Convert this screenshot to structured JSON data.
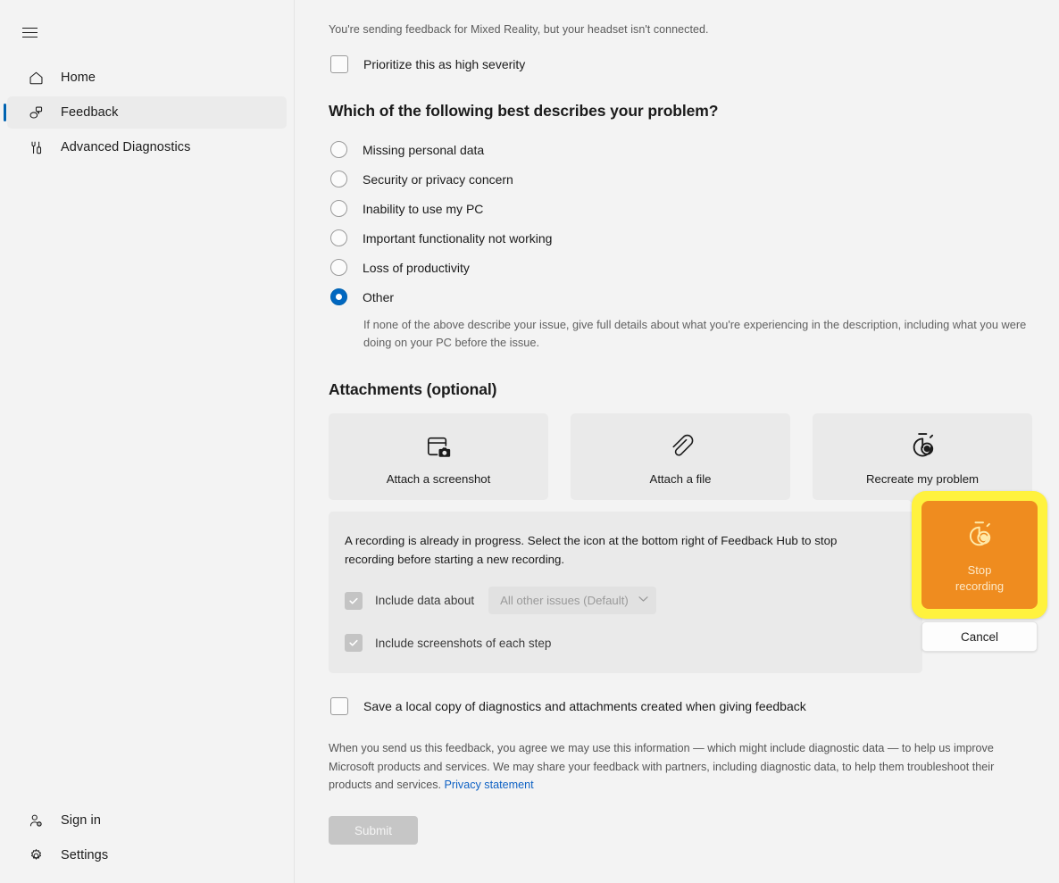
{
  "sidebar": {
    "menu_icon": "hamburger-icon",
    "items": [
      {
        "label": "Home",
        "icon": "home-icon",
        "selected": false
      },
      {
        "label": "Feedback",
        "icon": "feedback-icon",
        "selected": true
      },
      {
        "label": "Advanced Diagnostics",
        "icon": "diagnostics-icon",
        "selected": false
      }
    ],
    "bottom_items": [
      {
        "label": "Sign in",
        "icon": "add-user-icon"
      },
      {
        "label": "Settings",
        "icon": "gear-icon"
      }
    ]
  },
  "main": {
    "headset_note": "You're sending feedback for Mixed Reality, but your headset isn't connected.",
    "priority_checkbox": {
      "label": "Prioritize this as high severity",
      "checked": false
    },
    "problem_section": {
      "title": "Which of the following best describes your problem?",
      "options": [
        {
          "label": "Missing personal data",
          "selected": false
        },
        {
          "label": "Security or privacy concern",
          "selected": false
        },
        {
          "label": "Inability to use my PC",
          "selected": false
        },
        {
          "label": "Important functionality not working",
          "selected": false
        },
        {
          "label": "Loss of productivity",
          "selected": false
        },
        {
          "label": "Other",
          "selected": true
        }
      ],
      "help_text": "If none of the above describe your issue, give full details about what you're experiencing in the description, including what you were doing on your PC before the issue."
    },
    "attachments": {
      "title": "Attachments (optional)",
      "cards": [
        {
          "label": "Attach a screenshot",
          "icon": "screenshot-icon"
        },
        {
          "label": "Attach a file",
          "icon": "paperclip-icon"
        },
        {
          "label": "Recreate my problem",
          "icon": "stopwatch-icon"
        }
      ]
    },
    "recording_panel": {
      "message": "A recording is already in progress. Select the icon at the bottom right of Feedback Hub to stop recording before starting a new recording.",
      "include_data": {
        "label": "Include data about",
        "checked": true,
        "disabled": true,
        "dropdown_value": "All other issues (Default)",
        "dropdown_icon": "chevron-down-icon"
      },
      "include_screenshots": {
        "label": "Include screenshots of each step",
        "checked": true,
        "disabled": true
      }
    },
    "stop_flyout": {
      "stop_label": "Stop\nrecording",
      "stop_label_line1": "Stop",
      "stop_label_line2": "recording",
      "stop_icon": "stopwatch-icon",
      "cancel_label": "Cancel",
      "highlight_color": "#fff23e",
      "button_color": "#ef8c1f"
    },
    "save_local_checkbox": {
      "label": "Save a local copy of diagnostics and attachments created when giving feedback",
      "checked": false
    },
    "legal": {
      "text": "When you send us this feedback, you agree we may use this information — which might include diagnostic data — to help us improve Microsoft products and services. We may share your feedback with partners, including diagnostic data, to help them troubleshoot their products and services. ",
      "link_label": "Privacy statement",
      "link_color": "#0f62c4"
    },
    "submit": {
      "label": "Submit",
      "disabled": true
    }
  }
}
